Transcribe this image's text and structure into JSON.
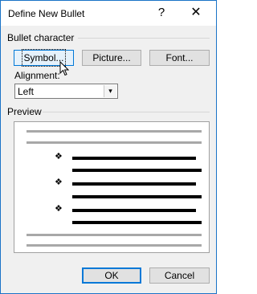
{
  "window": {
    "title": "Define New Bullet",
    "help_label": "?",
    "close_label": "✕"
  },
  "bullet_character": {
    "group_label": "Bullet character",
    "symbol_label": "Symbol...",
    "picture_label": "Picture...",
    "font_label": "Font..."
  },
  "alignment": {
    "label": "Alignment:",
    "selected": "Left",
    "arrow": "▾"
  },
  "preview": {
    "group_label": "Preview",
    "bullet_glyph": "❖"
  },
  "footer": {
    "ok_label": "OK",
    "cancel_label": "Cancel"
  }
}
